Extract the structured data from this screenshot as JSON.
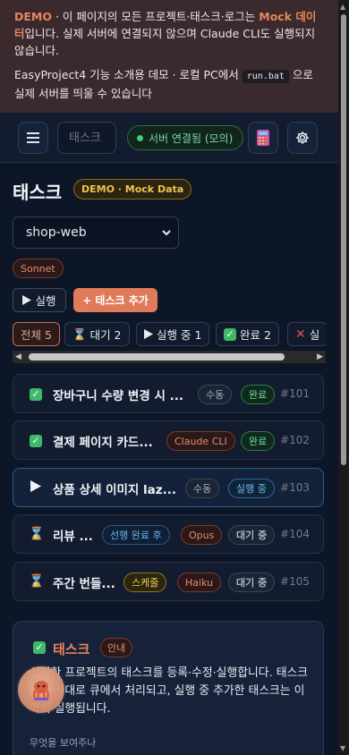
{
  "banner": {
    "line1_demo": "DEMO",
    "line1_mid": " · 이 페이지의 모든 프로젝트·태스크·로그는 ",
    "line1_mock": "Mock 데이터",
    "line1_end": "입니다. 실제 서버에 연결되지 않으며 Claude CLI도 실행되지 않습니다.",
    "line2_start": "EasyProject4 기능 소개용 데모 · 로컬 PC에서 ",
    "line2_code": "run.bat",
    "line2_end": " 으로 실제 서버를 띄울 수 있습니다"
  },
  "toolbar": {
    "menu_icon": "menu-icon",
    "search_placeholder": "태스크",
    "status_label": "서버 연결됨 (모의)",
    "calculator_icon": "calculator-icon",
    "settings_icon": "gear-icon"
  },
  "page": {
    "title": "태스크",
    "demo_badge": "DEMO · Mock Data",
    "project_select": "shop-web",
    "model_badge": "Sonnet",
    "run_label": "실행",
    "add_label": "+ 태스크 추가"
  },
  "filters": [
    {
      "label": "전체 5",
      "icon": ""
    },
    {
      "label": "대기 2",
      "icon": "hourglass-icon"
    },
    {
      "label": "실행 중 1",
      "icon": "play-icon"
    },
    {
      "label": "완료 2",
      "icon": "check-icon"
    },
    {
      "label": "실",
      "icon": "x-icon"
    }
  ],
  "tasks": [
    {
      "name": "장바구니 수량 변경 시 ...",
      "status_icon": "check-icon",
      "tags": [
        "수동",
        "완료"
      ],
      "number": "#101"
    },
    {
      "name": "결제 페이지 카드...",
      "status_icon": "check-icon",
      "tags": [
        "Claude CLI",
        "완료"
      ],
      "number": "#102"
    },
    {
      "name": "상품 상세 이미지 laz...",
      "status_icon": "play-icon",
      "tags": [
        "수동",
        "실행 중"
      ],
      "number": "#103"
    },
    {
      "name": "리뷰 ...",
      "status_icon": "hourglass-icon",
      "tags": [
        "선행 완료 후",
        "Opus",
        "대기 중"
      ],
      "number": "#104"
    },
    {
      "name": "주간 번들...",
      "status_icon": "hourglass-icon",
      "tags": [
        "스케줄",
        "Haiku",
        "대기 중"
      ],
      "number": "#105"
    }
  ],
  "help": {
    "title": "태스크",
    "badge": "안내",
    "text": "선택한 프로젝트의 태스크를 등록·수정·실행합니다. 태스크는 순서대로 큐에서 처리되고, 실행 중 추가한 태스크는 이어서 실행됩니다.",
    "question": "무엇을 보여주나"
  }
}
